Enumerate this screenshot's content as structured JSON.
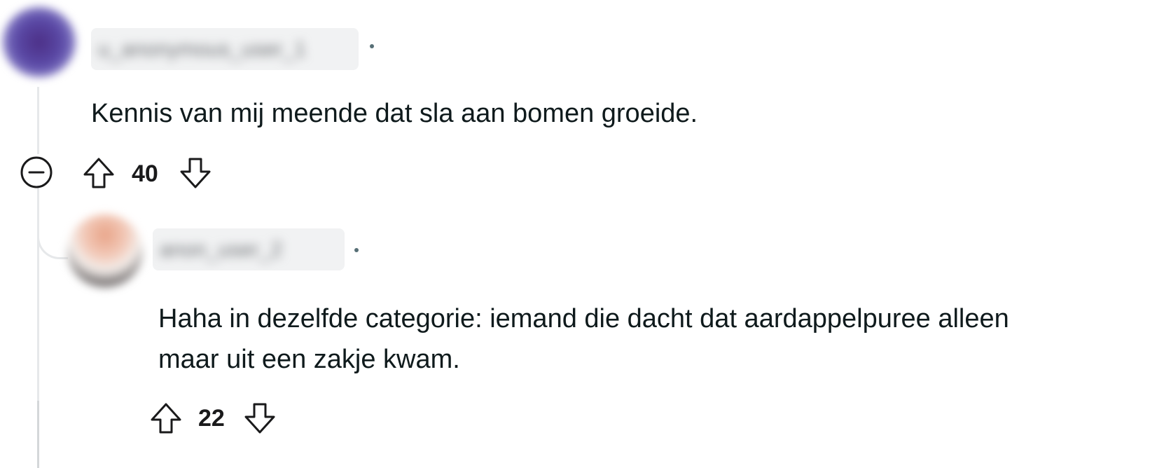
{
  "comments": [
    {
      "username": "u_anonymous_user_1",
      "separator": "•",
      "body": "Kennis van mij meende dat sla aan bomen groeide.",
      "score": "40"
    },
    {
      "username": "anon_user_2",
      "separator": "•",
      "body_line1": "Haha in dezelfde categorie: iemand die dacht dat aardappelpuree alleen",
      "body_line2": "maar uit een zakje kwam.",
      "score": "22"
    }
  ],
  "icons": {
    "collapse": "collapse-icon",
    "upvote": "upvote-arrow-icon",
    "downvote": "downvote-arrow-icon"
  },
  "colors": {
    "thread_line": "#e6e8ea",
    "text": "#0f1a1c",
    "meta_dot": "#576f76"
  }
}
